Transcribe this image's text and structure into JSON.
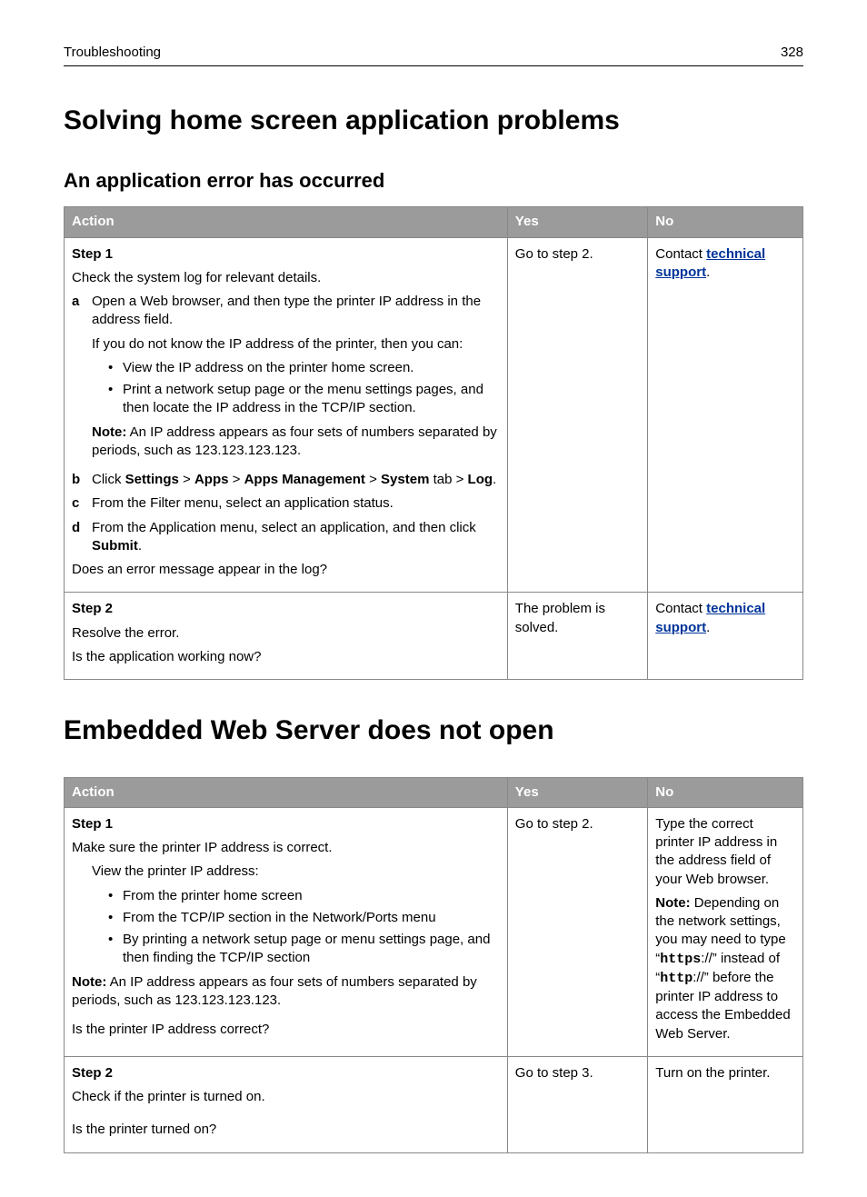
{
  "header": {
    "section": "Troubleshooting",
    "page": "328"
  },
  "h1_a": "Solving home screen application problems",
  "h2_a": "An application error has occurred",
  "th": {
    "action": "Action",
    "yes": "Yes",
    "no": "No"
  },
  "t1": {
    "r1": {
      "step": "Step 1",
      "intro": "Check the system log for relevant details.",
      "a_1": "Open a Web browser, and then type the printer IP address in the address field.",
      "a_if": "If you do not know the IP address of the printer, then you can:",
      "a_b1": "View the IP address on the printer home screen.",
      "a_b2": "Print a network setup page or the menu settings pages, and then locate the IP address in the TCP/IP section.",
      "a_note_b": "Note:",
      "a_note": " An IP address appears as four sets of numbers separated by periods, such as 123.123.123.123.",
      "b": {
        "pre": "Click ",
        "s1": "Settings",
        "s2": "Apps",
        "s3": "Apps Management",
        "s4": "System",
        "mid": " tab > ",
        "s5": "Log",
        "gt": " > ",
        "post": "."
      },
      "c": "From the Filter menu, select an application status.",
      "d_pre": "From the Application menu, select an application, and then click ",
      "d_b": "Submit",
      "d_post": ".",
      "q": "Does an error message appear in the log?",
      "yes": "Go to step 2.",
      "no_pre": "Contact ",
      "no_link": "technical support",
      "no_post": "."
    },
    "r2": {
      "step": "Step 2",
      "l1": "Resolve the error.",
      "q": "Is the application working now?",
      "yes": "The problem is solved.",
      "no_pre": "Contact ",
      "no_link": "technical support",
      "no_post": "."
    }
  },
  "h1_b": "Embedded Web Server does not open",
  "t2": {
    "r1": {
      "step": "Step 1",
      "l1": "Make sure the printer IP address is correct.",
      "l2": "View the printer IP address:",
      "b1": "From the printer home screen",
      "b2": "From the TCP/IP section in the Network/Ports menu",
      "b3": "By printing a network setup page or menu settings page, and then finding the TCP/IP section",
      "note_b": "Note:",
      "note": " An IP address appears as four sets of numbers separated by periods, such as 123.123.123.123.",
      "q": "Is the printer IP address correct?",
      "yes": "Go to step 2.",
      "no_p1": "Type the correct printer IP address in the address field of your Web browser.",
      "no_nb": "Note:",
      "no_t1": " Depending on the network settings, you may need to type “",
      "no_m1": "https",
      "no_t2": "://” instead of “",
      "no_m2": "http",
      "no_t3": "://” before the printer IP address to access the Embedded Web Server."
    },
    "r2": {
      "step": "Step 2",
      "l1": "Check if the printer is turned on.",
      "q": "Is the printer turned on?",
      "yes": "Go to step 3.",
      "no": "Turn on the printer."
    }
  }
}
